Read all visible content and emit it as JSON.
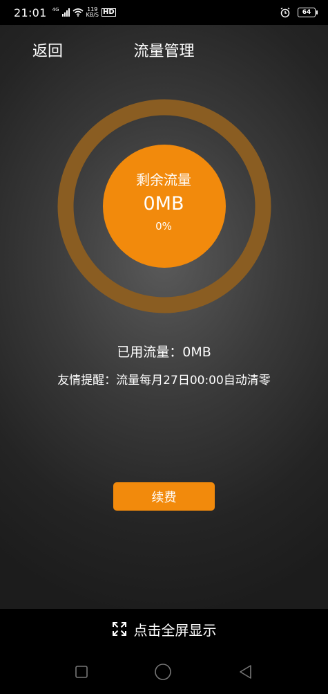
{
  "status_bar": {
    "time": "21:01",
    "network_label": "4G",
    "speed_value": "119",
    "speed_unit": "KB/S",
    "hd_label": "HD",
    "battery_level": "64"
  },
  "nav": {
    "back_label": "返回",
    "title": "流量管理"
  },
  "gauge": {
    "label": "剩余流量",
    "value": "0MB",
    "percent": "0%",
    "remaining_fraction": 0,
    "ring_color": "#8a5d22",
    "center_color": "#f28a0c"
  },
  "usage": {
    "used_text": "已用流量：0MB",
    "tip_text": "友情提醒：流量每月27日00:00自动清零"
  },
  "actions": {
    "renew_label": "续费",
    "accent_color": "#f28a0c"
  },
  "fullscreen": {
    "label": "点击全屏显示",
    "icon": "expand-icon"
  },
  "system_nav": {
    "icons": [
      "recent-apps-icon",
      "home-icon",
      "back-icon"
    ]
  }
}
